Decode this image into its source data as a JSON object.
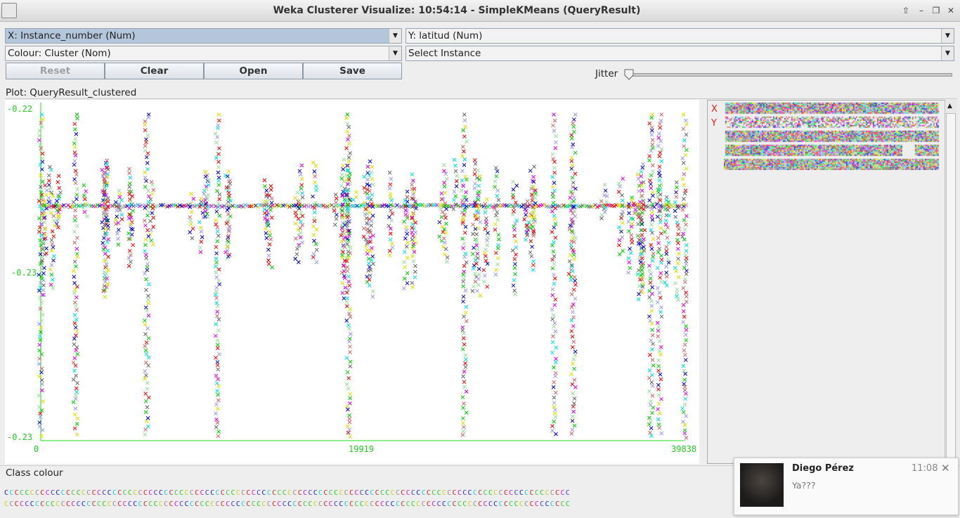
{
  "window": {
    "title": "Weka Clusterer Visualize: 10:54:14 - SimpleKMeans (QueryResult)",
    "buttons": [
      "up-arrow-icon",
      "minimize-icon",
      "restore-icon",
      "close-icon"
    ]
  },
  "controls": {
    "x_axis": "X: Instance_number (Num)",
    "y_axis": "Y: latitud (Num)",
    "colour": "Colour: Cluster (Nom)",
    "select_instance": "Select Instance",
    "reset_label": "Reset",
    "clear_label": "Clear",
    "open_label": "Open",
    "save_label": "Save",
    "jitter_label": "Jitter",
    "jitter_value": 0
  },
  "plot": {
    "title": "Plot: QueryResult_clustered",
    "y_ticks": [
      "-0.22",
      "-0.23",
      "-0.23"
    ],
    "x_ticks": [
      "0",
      "19919",
      "39838"
    ]
  },
  "side": {
    "x_label": "X",
    "y_label": "Y"
  },
  "class_colour": {
    "label": "Class colour",
    "glyph": "C",
    "colors": [
      "#1f1fd0",
      "#e02020",
      "#20d020",
      "#20d0d0",
      "#d020d0",
      "#d0d020",
      "#c03030",
      "#4040c0",
      "#909090",
      "#50c050"
    ]
  },
  "chart_data": {
    "type": "scatter",
    "title": "",
    "xlabel": "Instance_number",
    "ylabel": "latitud",
    "xlim": [
      0,
      39838
    ],
    "y_ticks": [
      "-0.22",
      "-0.23",
      "-0.23"
    ],
    "x_ticks": [
      "0",
      "19919",
      "39838"
    ],
    "marker": "x",
    "color_by": "Cluster",
    "palette": [
      "#0000cc",
      "#ee0000",
      "#00cc00",
      "#00dddd",
      "#dd00dd",
      "#dddd00",
      "#cc6666",
      "#666666",
      "#99dd99",
      "#9999ee"
    ],
    "notable_spikes_x": [
      2,
      2148,
      6560,
      10936,
      19040,
      26224,
      31768,
      32968,
      37784,
      38300,
      39838
    ]
  },
  "notification": {
    "name": "Diego Pérez",
    "time": "11:08",
    "message": "Ya???"
  }
}
